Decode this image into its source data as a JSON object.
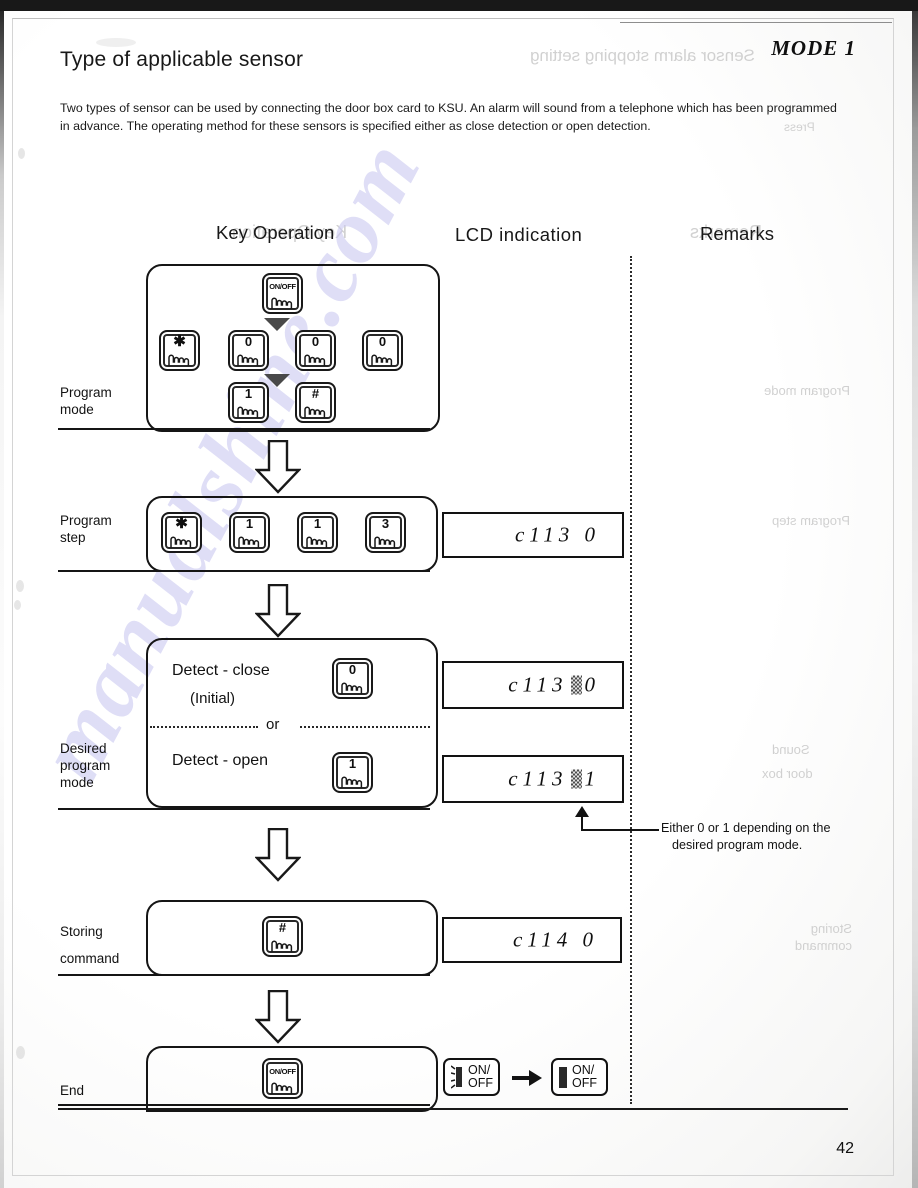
{
  "document": {
    "title": "Type of applicable sensor",
    "mode_label": "MODE  1",
    "intro": "Two types of sensor can be used by connecting the door box card to KSU. An alarm will sound from a telephone which has been programmed in advance. The operating method for these sensors is specified either as close detection or open detection.",
    "page_number": "42",
    "watermark_text": "manualshine.com"
  },
  "columns": {
    "key_operation": "Key Operation",
    "lcd_indication": "LCD  indication",
    "remarks": "Remarks"
  },
  "rows": {
    "program_mode": {
      "label_line1": "Program",
      "label_line2": "mode",
      "keys_top": [
        {
          "glyph": "ON/OFF",
          "name": "on-off"
        }
      ],
      "keys_middle": [
        {
          "glyph": "✱",
          "name": "asterisk"
        },
        {
          "glyph": "0",
          "name": "zero"
        },
        {
          "glyph": "0",
          "name": "zero"
        },
        {
          "glyph": "0",
          "name": "zero"
        }
      ],
      "keys_bottom": [
        {
          "glyph": "1",
          "name": "one"
        },
        {
          "glyph": "#",
          "name": "hash"
        }
      ]
    },
    "program_step": {
      "label_line1": "Program",
      "label_line2": "step",
      "keys": [
        {
          "glyph": "✱",
          "name": "asterisk"
        },
        {
          "glyph": "1",
          "name": "one"
        },
        {
          "glyph": "1",
          "name": "one"
        },
        {
          "glyph": "3",
          "name": "three"
        }
      ],
      "lcd": "c113  0"
    },
    "desired_program_mode": {
      "label_line1": "Desired",
      "label_line2": "program",
      "label_line3": "mode",
      "option_close": {
        "text": "Detect - close",
        "sub": "(Initial)",
        "key": {
          "glyph": "0",
          "name": "zero"
        },
        "lcd_prefix": "c113",
        "lcd_suffix": "0"
      },
      "separator": "or",
      "option_open": {
        "text": "Detect - open",
        "key": {
          "glyph": "1",
          "name": "one"
        },
        "lcd_prefix": "c113",
        "lcd_suffix": "1"
      },
      "annotation_line1": "Either 0 or 1 depending on the",
      "annotation_line2": "desired program mode."
    },
    "storing_command": {
      "label_line1": "Storing",
      "label_line2": "command",
      "key": {
        "glyph": "#",
        "name": "hash"
      },
      "lcd": "c114  0"
    },
    "end": {
      "label": "End",
      "key": {
        "glyph": "ON/OFF",
        "name": "on-off"
      },
      "indicator_flashing_line1": "ON/",
      "indicator_flashing_line2": "OFF",
      "indicator_solid_line1": "ON/",
      "indicator_solid_line2": "OFF"
    }
  },
  "ghosts": {
    "g1": "Sensor alarm stopping setting",
    "g2": "Key Operation",
    "g3": "Remarks",
    "g4": "Program mode",
    "g5": "Program step",
    "g6": "Storing command",
    "g7": "Sound",
    "g8": "door box",
    "g9": "Press"
  },
  "colors": {
    "ink": "#171717",
    "paper": "#ffffff",
    "watermark": "#c9c8ee"
  }
}
